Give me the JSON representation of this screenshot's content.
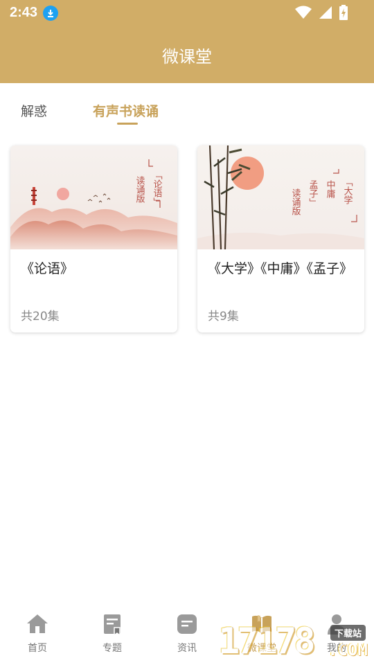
{
  "status_bar": {
    "time": "2:43"
  },
  "header": {
    "title": "微课堂"
  },
  "tabs": [
    {
      "label": "解惑"
    },
    {
      "label": "有声书读诵"
    }
  ],
  "cards": [
    {
      "title": "《论语》",
      "count": "共20集",
      "cover_text": [
        "「论语」",
        "读诵版"
      ]
    },
    {
      "title": "《大学》《中庸》《孟子》",
      "count": "共9集",
      "cover_text": [
        "「大学",
        "中庸",
        "孟子」",
        "读诵版"
      ]
    }
  ],
  "bottom_nav": {
    "items": [
      {
        "label": "首页",
        "icon": "home-icon"
      },
      {
        "label": "专题",
        "icon": "topic-icon"
      },
      {
        "label": "资讯",
        "icon": "news-icon"
      },
      {
        "label": "微课堂",
        "icon": "book-icon"
      },
      {
        "label": "我的",
        "icon": "user-icon"
      }
    ],
    "active_index": 3
  },
  "watermark": {
    "digits": "17178",
    "suffix": ".COM",
    "tag": "下载站"
  },
  "colors": {
    "brand": "#d1ad67",
    "accent": "#c8a25a",
    "nav_inactive": "#9a9a9a"
  }
}
